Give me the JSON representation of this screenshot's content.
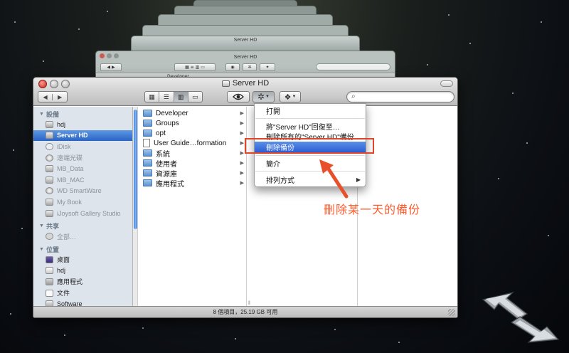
{
  "app": {
    "window_title": "Server HD",
    "history_window_title": "Server HD",
    "ghost_labels": [
      "Developer"
    ]
  },
  "toolbar": {
    "back": "◀",
    "forward": "▶",
    "view_modes": [
      "icon",
      "list",
      "column",
      "coverflow"
    ],
    "selected_view": "column",
    "search_placeholder": ""
  },
  "sidebar": {
    "devices_header": "設備",
    "devices": [
      {
        "label": "hdj",
        "icon": "computer-icon",
        "state": "normal"
      },
      {
        "label": "Server HD",
        "icon": "drive-icon",
        "state": "selected"
      },
      {
        "label": "iDisk",
        "icon": "idisk-icon",
        "state": "dim"
      },
      {
        "label": "遠端光碟",
        "icon": "disc-icon",
        "state": "dim"
      },
      {
        "label": "MB_Data",
        "icon": "drive-icon",
        "state": "dim"
      },
      {
        "label": "MB_MAC",
        "icon": "drive-icon",
        "state": "dim"
      },
      {
        "label": "WD SmartWare",
        "icon": "drive-icon",
        "state": "dim"
      },
      {
        "label": "My Book",
        "icon": "drive-icon",
        "state": "dim"
      },
      {
        "label": "iJoysoft Gallery Studio",
        "icon": "drive-icon",
        "state": "dim"
      }
    ],
    "shared_header": "共享",
    "shared": [
      {
        "label": "全部…",
        "icon": "network-icon",
        "state": "dim"
      }
    ],
    "places_header": "位置",
    "places": [
      {
        "label": "桌面",
        "icon": "desktop-icon",
        "state": "normal"
      },
      {
        "label": "hdj",
        "icon": "home-icon",
        "state": "normal"
      },
      {
        "label": "應用程式",
        "icon": "apps-icon",
        "state": "normal"
      },
      {
        "label": "文件",
        "icon": "documents-icon",
        "state": "normal"
      },
      {
        "label": "Software",
        "icon": "folder-icon",
        "state": "normal"
      }
    ]
  },
  "column1": [
    {
      "label": "Developer",
      "type": "folder"
    },
    {
      "label": "Groups",
      "type": "folder"
    },
    {
      "label": "opt",
      "type": "folder"
    },
    {
      "label": "User Guide…formation",
      "type": "doc"
    },
    {
      "label": "系統",
      "type": "folder"
    },
    {
      "label": "使用者",
      "type": "folder"
    },
    {
      "label": "資源庫",
      "type": "folder"
    },
    {
      "label": "應用程式",
      "type": "folder"
    }
  ],
  "status_text": "8 個項目，25.19 GB 可用",
  "menu": {
    "open": "打開",
    "restore": "將\"Server HD\"回復至…",
    "delete_all": "刪除所有的\"Server HD\"備份",
    "delete_backup": "刪除備份",
    "get_info": "簡介",
    "arrange_by": "排列方式"
  },
  "annotation": {
    "text": "刪除某一天的備份",
    "color": "#ff5a2c"
  },
  "colors": {
    "selection": "#2a64c6",
    "accent_red": "#e0452a"
  }
}
